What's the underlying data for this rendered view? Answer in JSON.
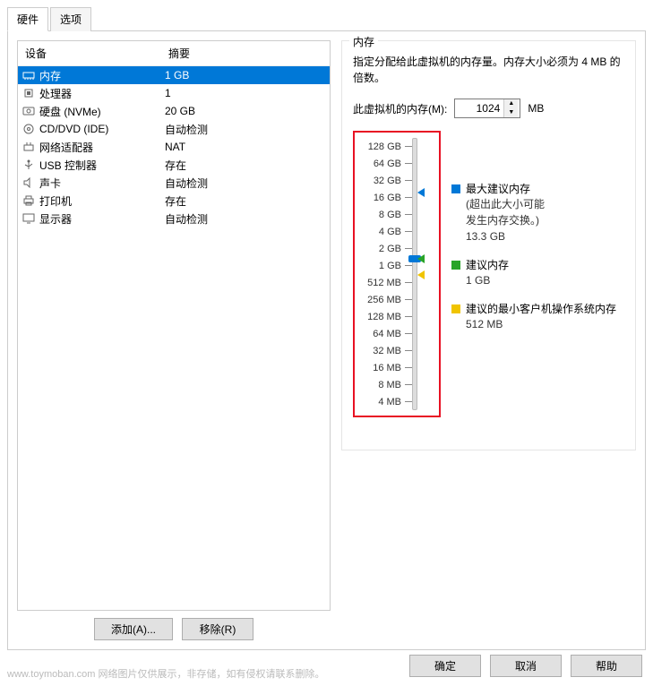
{
  "tabs": {
    "hardware": "硬件",
    "options": "选项"
  },
  "cols": {
    "device": "设备",
    "summary": "摘要"
  },
  "rows": [
    {
      "icon": "mem",
      "dev": "内存",
      "sum": "1 GB",
      "sel": true
    },
    {
      "icon": "cpu",
      "dev": "处理器",
      "sum": "1"
    },
    {
      "icon": "hdd",
      "dev": "硬盘 (NVMe)",
      "sum": "20 GB"
    },
    {
      "icon": "cd",
      "dev": "CD/DVD (IDE)",
      "sum": "自动检测"
    },
    {
      "icon": "net",
      "dev": "网络适配器",
      "sum": "NAT"
    },
    {
      "icon": "usb",
      "dev": "USB 控制器",
      "sum": "存在"
    },
    {
      "icon": "snd",
      "dev": "声卡",
      "sum": "自动检测"
    },
    {
      "icon": "prn",
      "dev": "打印机",
      "sum": "存在"
    },
    {
      "icon": "mon",
      "dev": "显示器",
      "sum": "自动检测"
    }
  ],
  "btns": {
    "add": "添加(A)...",
    "remove": "移除(R)"
  },
  "panel": {
    "title": "内存",
    "desc": "指定分配给此虚拟机的内存量。内存大小必须为 4 MB 的倍数。",
    "label": "此虚拟机的内存(M):",
    "value": "1024",
    "unit": "MB"
  },
  "ticks": [
    "128 GB",
    "64 GB",
    "32 GB",
    "16 GB",
    "8 GB",
    "4 GB",
    "2 GB",
    "1 GB",
    "512 MB",
    "256 MB",
    "128 MB",
    "64 MB",
    "32 MB",
    "16 MB",
    "8 MB",
    "4 MB"
  ],
  "legend": {
    "max": {
      "t": "最大建议内存",
      "s1": "(超出此大小可能",
      "s2": "发生内存交换。)",
      "v": "13.3 GB",
      "c": "#0078d7"
    },
    "rec": {
      "t": "建议内存",
      "v": "1 GB",
      "c": "#28a428"
    },
    "min": {
      "t": "建议的最小客户机操作系统内存",
      "v": "512 MB",
      "c": "#f0c400"
    }
  },
  "footer": {
    "ok": "确定",
    "cancel": "取消",
    "help": "帮助"
  },
  "watermark": "www.toymoban.com 网络图片仅供展示，非存储，如有侵权请联系删除。"
}
